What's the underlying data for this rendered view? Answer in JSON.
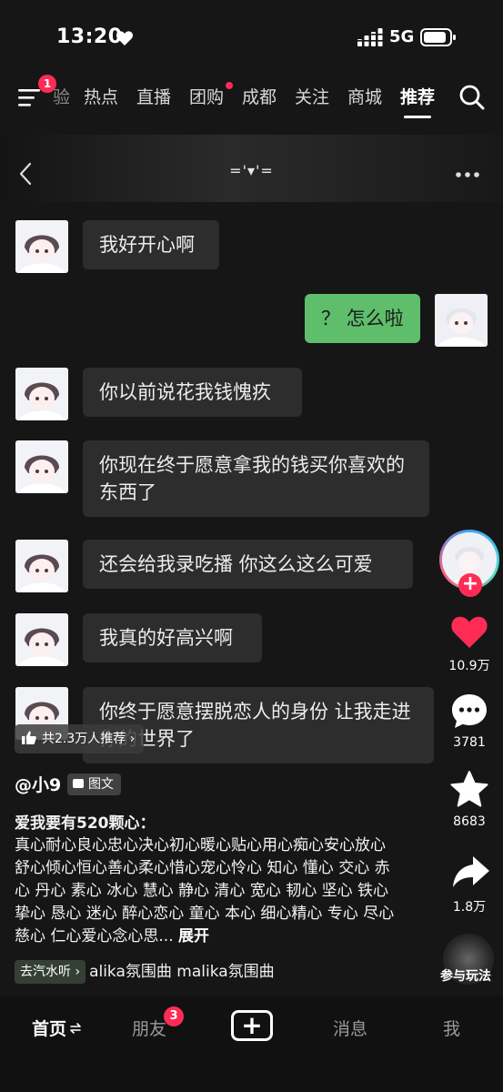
{
  "status_bar": {
    "time": "13:20",
    "network": "5G"
  },
  "top_nav": {
    "menu_badge": "1",
    "tabs": [
      {
        "label": "验",
        "partial": true
      },
      {
        "label": "热点"
      },
      {
        "label": "直播"
      },
      {
        "label": "团购",
        "dot": true
      },
      {
        "label": "成都"
      },
      {
        "label": "关注"
      },
      {
        "label": "商城"
      },
      {
        "label": "推荐",
        "active": true
      }
    ]
  },
  "chat_header": {
    "title": "='▾'="
  },
  "messages": [
    {
      "from": "other",
      "text": "我好开心啊"
    },
    {
      "from": "me",
      "text": "？ 怎么啦"
    },
    {
      "from": "other",
      "text": "你以前说花我钱愧疚"
    },
    {
      "from": "other",
      "text": "你现在终于愿意拿我的钱买你喜欢的东西了"
    },
    {
      "from": "other",
      "text": "还会给我录吃播 你这么这么可爱"
    },
    {
      "from": "other",
      "text": "我真的好高兴啊"
    },
    {
      "from": "other",
      "text": "你终于愿意摆脱恋人的身份 让我走进你的世界了"
    }
  ],
  "overlay": {
    "recommend_label": "共2.3万人推荐",
    "author": "@小9",
    "type_tag": "图文",
    "caption_title": "爱我要有520颗心：",
    "caption_body": "真心耐心良心忠心决心初心暖心贴心用心痴心安心放心舒心倾心恒心善心柔心惜心宠心怜心 知心 懂心 交心 赤心 丹心 素心 冰心 慧心 静心 清心 宽心 韧心 坚心 铁心 挚心 恳心 迷心 醉心恋心 童心 本心 细心精心 专心 尽心 慈心 仁心爱心念心思...",
    "expand_label": "展开",
    "car_listen_label": "去汽水听",
    "music_text": "alika氛围曲   malika氛围曲"
  },
  "rail": {
    "like_count": "10.9万",
    "comment_count": "3781",
    "favorite_count": "8683",
    "share_count": "1.8万",
    "play_label": "参与玩法",
    "like_color": "#fe2c55"
  },
  "bottom_bar": {
    "home": "首页",
    "friends": "朋友",
    "friends_badge": "3",
    "messages": "消息",
    "me": "我"
  }
}
